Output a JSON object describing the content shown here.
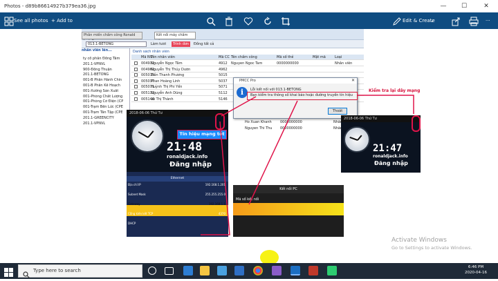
{
  "window": {
    "title": "Photos - d89b86614927b379ea36.jpg",
    "min": "—",
    "max": "☐",
    "close": "✕"
  },
  "toolbar": {
    "see_all": "See all photos",
    "add_to": "+ Add to",
    "edit_create": "Edit & Create",
    "edit_chevron": "⌄",
    "more": "···"
  },
  "app_screen": {
    "tab1": "Phân miền chấm công Ronald Jack Pro",
    "tab2": "Kết nối máy chấm công",
    "toolbar_combo": "013.1-BETONG",
    "btn_refresh": "Làm tươi",
    "btn_menu": "Trình đơn",
    "btn_sync": "Đồng tất cả",
    "left_header": "nhân viên lên...",
    "list_header": "Danh sách nhân viên",
    "columns": [
      "Mã NV",
      "Tên nhân viên",
      "Mã CC",
      "Tên chấm công",
      "Mã số thẻ",
      "Mật mã",
      "Loại"
    ],
    "rows": [
      [
        "004912",
        "Nguyễn Ngọc Tâm",
        "4912",
        "Nguyen Ngoc Tam",
        "0000000000",
        "",
        "Nhân viên"
      ],
      [
        "004962",
        "Nguyễn Thị Thúy Dươn",
        "4962",
        "",
        "",
        "",
        ""
      ],
      [
        "005015",
        "Trần Thanh Phương",
        "5015",
        "",
        "",
        "",
        ""
      ],
      [
        "005037",
        "Phan Hoàng Linh",
        "5037",
        "",
        "",
        "",
        ""
      ],
      [
        "005071",
        "Huỳnh Thị Phi Yến",
        "5071",
        "",
        "",
        "",
        ""
      ],
      [
        "005112",
        "Nguyễn Anh Dũng",
        "5112",
        "",
        "",
        "",
        ""
      ],
      [
        "005146",
        "Võ Thị Thành",
        "5146",
        "",
        "",
        "",
        ""
      ]
    ],
    "tree": [
      "ty cổ phần Đồng Tâm",
      "201.1-VPNVL",
      "900-Đồng Thuận",
      "201.1-BETONG",
      "001-B Phần Hành Chín",
      "001-B Phần Kế Hoạch",
      "001-Xưởng Sản Xuất",
      "001-Phòng Chất Lượng",
      "001-Phòng Cơ Điện (CP",
      "001-Trạm Bến Lức (CPE",
      "001-Trạm Tân Tập (CPE",
      "201.1-GREENCITY",
      "201.1-VPNVL"
    ],
    "extra_rows": [
      [
        "Ho Xuan Khanh",
        "0000000000",
        "Nhân viên"
      ],
      [
        "Nguyen Thi Thu",
        "0000000000",
        "Nhân viên"
      ]
    ]
  },
  "dialog": {
    "title": "PMCC Pro",
    "close": "✕",
    "icon": "i",
    "line1": "Lỗi kết nối với 013.1-BETONG",
    "line2": "Bạn kiểm tra thông số khai báo hoặc đường truyền tín hiệu",
    "ok": "Thoát"
  },
  "annotations": {
    "signal_good": "Tín hiệu mạng tốt",
    "check_network": "Kiểm tra lại dây mạng"
  },
  "phone1": {
    "date": "2018-06-06  Thứ Tư",
    "time": "21:48",
    "site": "ronaldjack.info",
    "login": "Đăng nhập",
    "eth_title": "Ethernet",
    "eth_rows": [
      {
        "label": "Địa chỉ IP",
        "value": "192.168.1.201"
      },
      {
        "label": "Subnet Mask",
        "value": "255.255.255.0"
      },
      {
        "label": "Gateway",
        "value": "192.168.1.1"
      },
      {
        "label": "Cổng kiến kết TCP",
        "value": "4370"
      },
      {
        "label": "DHCP",
        "value": ""
      }
    ]
  },
  "phone2": {
    "title": "Kết nối PC",
    "label": "Mã số kết nối"
  },
  "phone3": {
    "date": "2018-06-06  Thứ Tư",
    "time": "21:47",
    "site": "ronaldjack.info",
    "login": "Đăng nhập"
  },
  "activation": {
    "line1": "Activate Windows",
    "line2": "Go to Settings to activate Windows."
  },
  "taskbar": {
    "search_placeholder": "Type here to search",
    "time": "6:46 PM",
    "date": "2020-04-16"
  },
  "colors": {
    "toolbar_bg": "#0f4c81",
    "annotation_red": "#e0144a",
    "taskbar_bg": "#1f2a38"
  }
}
